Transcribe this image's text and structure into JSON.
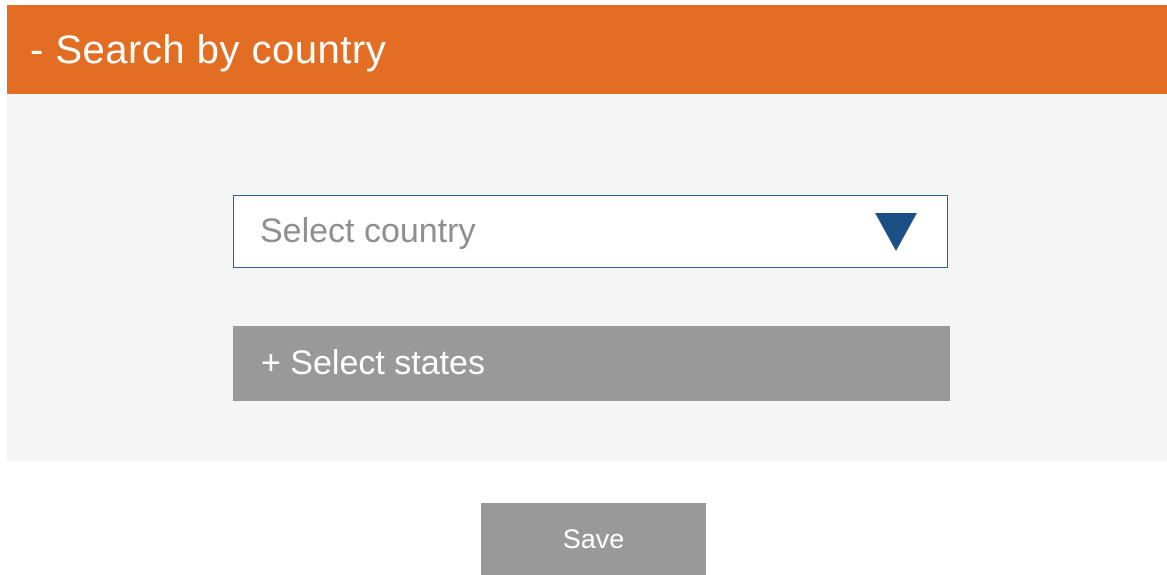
{
  "panel": {
    "toggle_symbol": "-",
    "title": "Search by country",
    "header_color": "#e36d23"
  },
  "country_select": {
    "placeholder": "Select country",
    "arrow_icon": "triangle-down-icon",
    "arrow_color": "#1b4f86"
  },
  "states_toggle": {
    "label": "+ Select states"
  },
  "actions": {
    "save_label": "Save"
  }
}
